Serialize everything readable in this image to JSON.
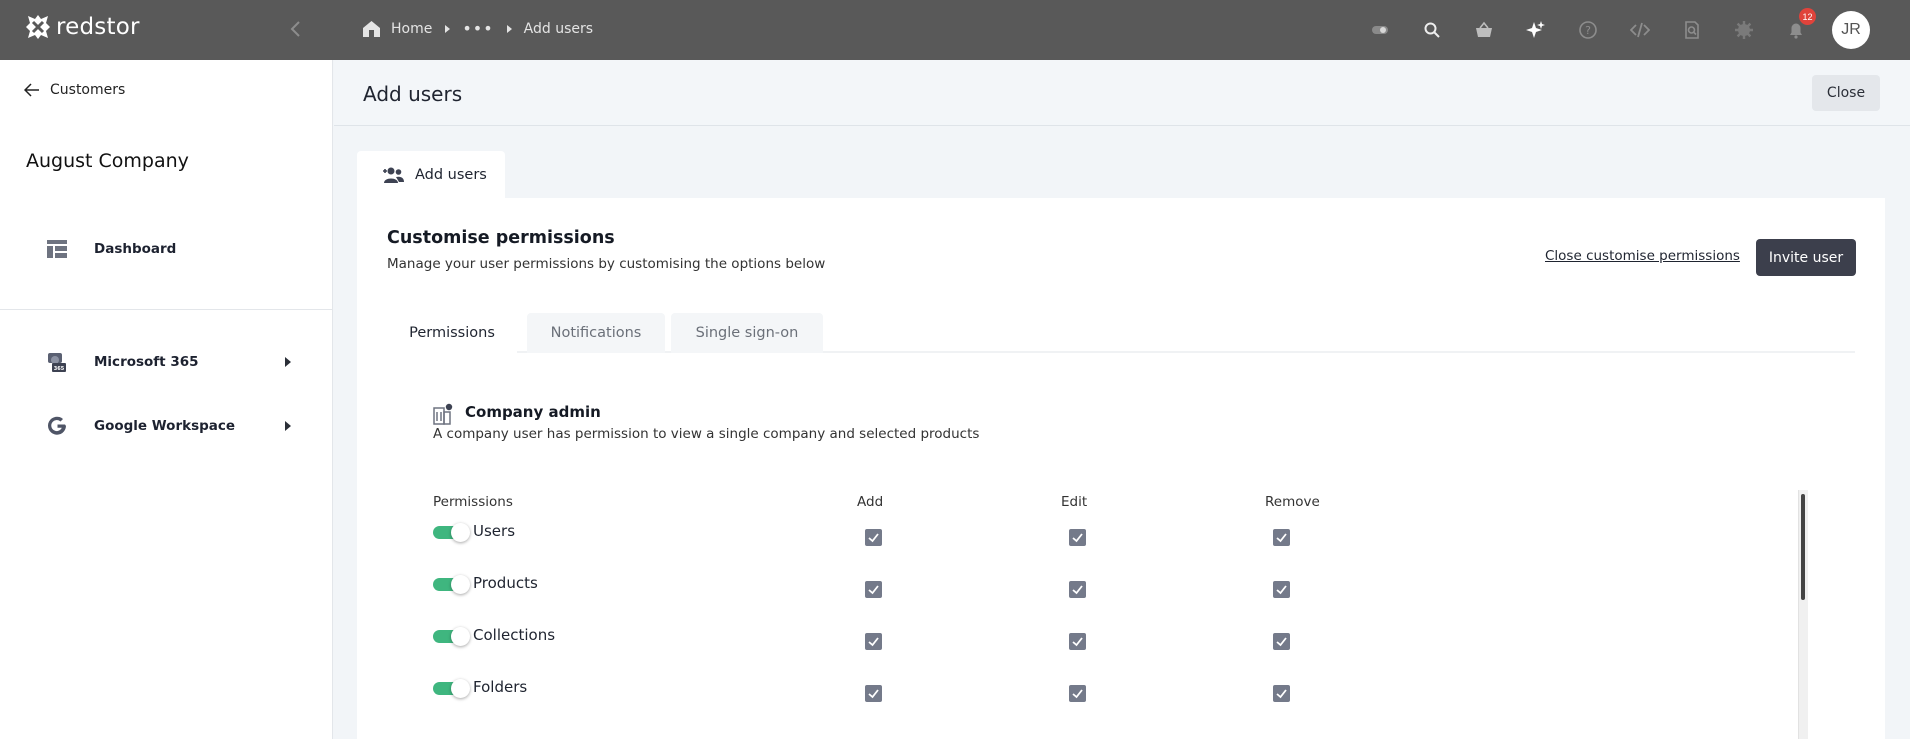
{
  "topbar": {
    "brand": "redstor",
    "breadcrumb": {
      "home": "Home",
      "more": "•••",
      "current": "Add users"
    },
    "icons": [
      "toggle-icon",
      "search-icon",
      "basket-icon",
      "sparkle-icon",
      "help-icon",
      "code-icon",
      "document-search-icon",
      "gear-icon",
      "bell-icon"
    ],
    "notification_count": "12",
    "user_initials": "JR"
  },
  "sidebar": {
    "back_label": "Customers",
    "company_name": "August Company",
    "items": [
      {
        "label": "Dashboard",
        "icon": "dashboard-icon"
      },
      {
        "label": "Microsoft 365",
        "icon": "microsoft-365-icon"
      },
      {
        "label": "Google Workspace",
        "icon": "google-icon"
      }
    ]
  },
  "page": {
    "title": "Add users",
    "close_label": "Close",
    "main_tab_label": "Add users"
  },
  "panel": {
    "title": "Customise permissions",
    "subtitle": "Manage your user permissions by customising the options below",
    "close_customise_label": "Close customise permissions",
    "invite_label": "Invite user",
    "tabs": [
      "Permissions",
      "Notifications",
      "Single sign-on"
    ],
    "active_tab": "Permissions"
  },
  "role": {
    "title": "Company admin",
    "description": "A company user has permission to view a single company and selected products"
  },
  "permissions": {
    "columns": [
      "Permissions",
      "Add",
      "Edit",
      "Remove"
    ],
    "rows": [
      {
        "label": "Users",
        "enabled": true,
        "add": true,
        "edit": true,
        "remove": true
      },
      {
        "label": "Products",
        "enabled": true,
        "add": true,
        "edit": true,
        "remove": true
      },
      {
        "label": "Collections",
        "enabled": true,
        "add": true,
        "edit": true,
        "remove": true
      },
      {
        "label": "Folders",
        "enabled": true,
        "add": true,
        "edit": true,
        "remove": true
      }
    ]
  },
  "colors": {
    "topbar": "#595959",
    "accent_toggle": "#3fb67f",
    "checkbox": "#747a8a",
    "invite_button": "#3c3f4c",
    "badge": "#e0433b"
  }
}
